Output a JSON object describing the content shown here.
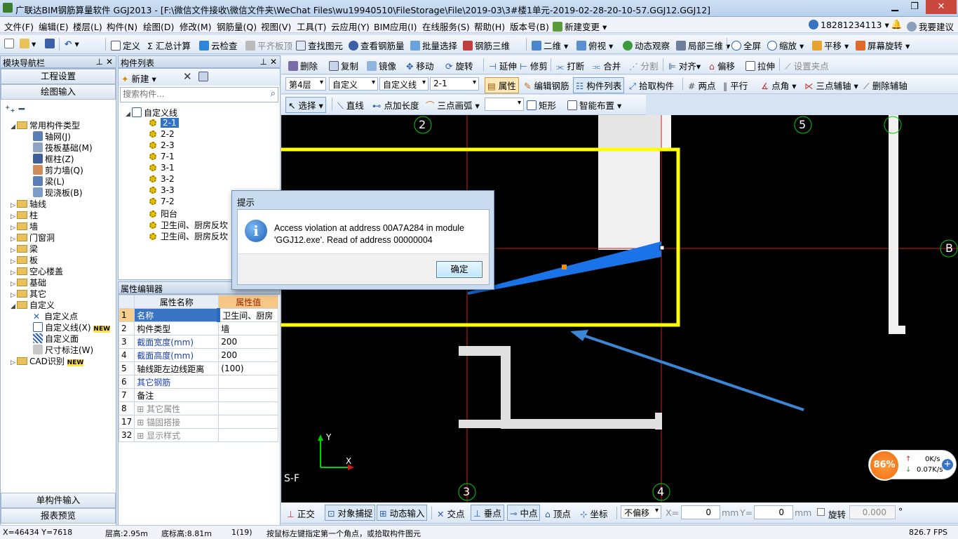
{
  "window": {
    "title": "广联达BIM钢筋算量软件 GGJ2013 - [F:\\微信文件接收\\微信文件夹\\WeChat Files\\wu19940510\\FileStorage\\File\\2019-03\\3#楼1单元-2019-02-28-20-10-57.GGJ12.GGJ12]"
  },
  "menu": [
    "文件(F)",
    "编辑(E)",
    "楼层(L)",
    "构件(N)",
    "绘图(D)",
    "修改(M)",
    "钢筋量(Q)",
    "视图(V)",
    "工具(T)",
    "云应用(Y)",
    "BIM应用(I)",
    "在线服务(S)",
    "帮助(H)",
    "版本号(B)",
    "新建变更"
  ],
  "account": {
    "phone": "18281234113",
    "suggest": "我要建议"
  },
  "toolbar1": {
    "define": "定义",
    "sum": "Σ 汇总计算",
    "cloud_check": "云检查",
    "flat_top": "平齐板顶",
    "find": "查找图元",
    "view_rebar": "查看钢筋量",
    "batch": "批量选择",
    "rebar3d": "钢筋三维",
    "view2d": "二维",
    "top_view": "俯视",
    "dyn_view": "动态观察",
    "local3d": "局部三维",
    "fullscreen": "全屏",
    "zoom": "缩放",
    "pan": "平移",
    "screen_rotate": "屏幕旋转"
  },
  "toolbar2": {
    "delete": "删除",
    "copy": "复制",
    "mirror": "镜像",
    "move": "移动",
    "rotate": "旋转",
    "extend": "延伸",
    "trim": "修剪",
    "break": "打断",
    "merge": "合并",
    "split": "分割",
    "align": "对齐",
    "offset": "偏移",
    "stretch": "拉伸",
    "set_grip": "设置夹点"
  },
  "toolbar3": {
    "floor": "第4层",
    "type": "自定义",
    "sub": "自定义线",
    "item": "2-1",
    "props": "属性",
    "edit_rebar": "编辑钢筋",
    "comp_list": "构件列表",
    "pick": "拾取构件",
    "two_pt": "两点",
    "parallel": "平行",
    "pt_angle": "点角",
    "three_aux": "三点辅轴",
    "del_aux": "删除辅轴"
  },
  "toolbar4": {
    "select": "选择",
    "line": "直线",
    "pt_len": "点加长度",
    "arc": "三点画弧",
    "rect": "矩形",
    "smart": "智能布置"
  },
  "nav": {
    "title": "模块导航栏",
    "project": "工程设置",
    "draw_input": "绘图输入",
    "single": "单构件输入",
    "report": "报表预览",
    "tree": [
      {
        "label": "常用构件类型",
        "level": 0
      },
      {
        "label": "轴网(J)",
        "level": 1
      },
      {
        "label": "筏板基础(M)",
        "level": 1
      },
      {
        "label": "框柱(Z)",
        "level": 1
      },
      {
        "label": "剪力墙(Q)",
        "level": 1
      },
      {
        "label": "梁(L)",
        "level": 1
      },
      {
        "label": "现浇板(B)",
        "level": 1
      },
      {
        "label": "轴线",
        "level": 0
      },
      {
        "label": "柱",
        "level": 0
      },
      {
        "label": "墙",
        "level": 0
      },
      {
        "label": "门窗洞",
        "level": 0
      },
      {
        "label": "梁",
        "level": 0
      },
      {
        "label": "板",
        "level": 0
      },
      {
        "label": "空心楼盖",
        "level": 0
      },
      {
        "label": "基础",
        "level": 0
      },
      {
        "label": "其它",
        "level": 0
      },
      {
        "label": "自定义",
        "level": 0
      },
      {
        "label": "自定义点",
        "level": 1
      },
      {
        "label": "自定义线(X)",
        "level": 1,
        "badge": "NEW"
      },
      {
        "label": "自定义面",
        "level": 1
      },
      {
        "label": "尺寸标注(W)",
        "level": 1
      },
      {
        "label": "CAD识别",
        "level": 0,
        "badge": "NEW"
      }
    ]
  },
  "comp_list": {
    "title": "构件列表",
    "new": "新建",
    "search_placeholder": "搜索构件...",
    "root": "自定义线",
    "items": [
      "2-1",
      "2-2",
      "2-3",
      "7-1",
      "3-1",
      "3-2",
      "3-3",
      "7-2",
      "阳台",
      "卫生间、厨房反坎",
      "卫生间、厨房反坎"
    ]
  },
  "prop_editor": {
    "title": "属性编辑器",
    "col_name": "属性名称",
    "col_value": "属性值",
    "rows": [
      {
        "no": "1",
        "name": "名称",
        "value": "卫生间、厨房"
      },
      {
        "no": "2",
        "name": "构件类型",
        "value": "墙"
      },
      {
        "no": "3",
        "name": "截面宽度(mm)",
        "value": "200"
      },
      {
        "no": "4",
        "name": "截面高度(mm)",
        "value": "200"
      },
      {
        "no": "5",
        "name": "轴线距左边线距离",
        "value": "(100)"
      },
      {
        "no": "6",
        "name": "其它钢筋",
        "value": ""
      },
      {
        "no": "7",
        "name": "备注",
        "value": ""
      },
      {
        "no": "8",
        "name": "其它属性",
        "value": "",
        "group": true
      },
      {
        "no": "17",
        "name": "锚固搭接",
        "value": "",
        "group": true
      },
      {
        "no": "32",
        "name": "显示样式",
        "value": "",
        "group": true
      }
    ]
  },
  "canvas": {
    "axes": [
      "2",
      "5",
      "3",
      "4",
      "B"
    ],
    "corner_label": "S-F",
    "axis_y": "Y",
    "axis_x": "X"
  },
  "dialog": {
    "title": "提示",
    "message": "Access violation at address 00A7A284 in module 'GGJ12.exe'. Read of address 00000004",
    "ok": "确定"
  },
  "snapbar": {
    "ortho": "正交",
    "snap": "对象捕捉",
    "dyn": "动态输入",
    "intersect": "交点",
    "perp": "垂点",
    "mid": "中点",
    "vertex": "顶点",
    "coord": "坐标",
    "no_offset": "不偏移",
    "x_label": "X=",
    "x_val": "0",
    "y_label": "Y=",
    "y_val": "0",
    "unit": "mm",
    "rotate": "旋转",
    "rot_val": "0.000",
    "deg": "°"
  },
  "status": {
    "coords": "X=46434 Y=7618",
    "floor_h": "层高:2.95m",
    "bottom_h": "底标高:8.81m",
    "count": "1(19)",
    "hint": "按鼠标左键指定第一个角点，或拾取构件图元",
    "fps": "826.7 FPS"
  },
  "gauge": {
    "percent": "86%",
    "up": "0K/s",
    "down": "0.07K/s"
  },
  "colors": {
    "highlight": "#ffff00",
    "arrow": "#3b86d6",
    "bar": "#1a73e8"
  }
}
